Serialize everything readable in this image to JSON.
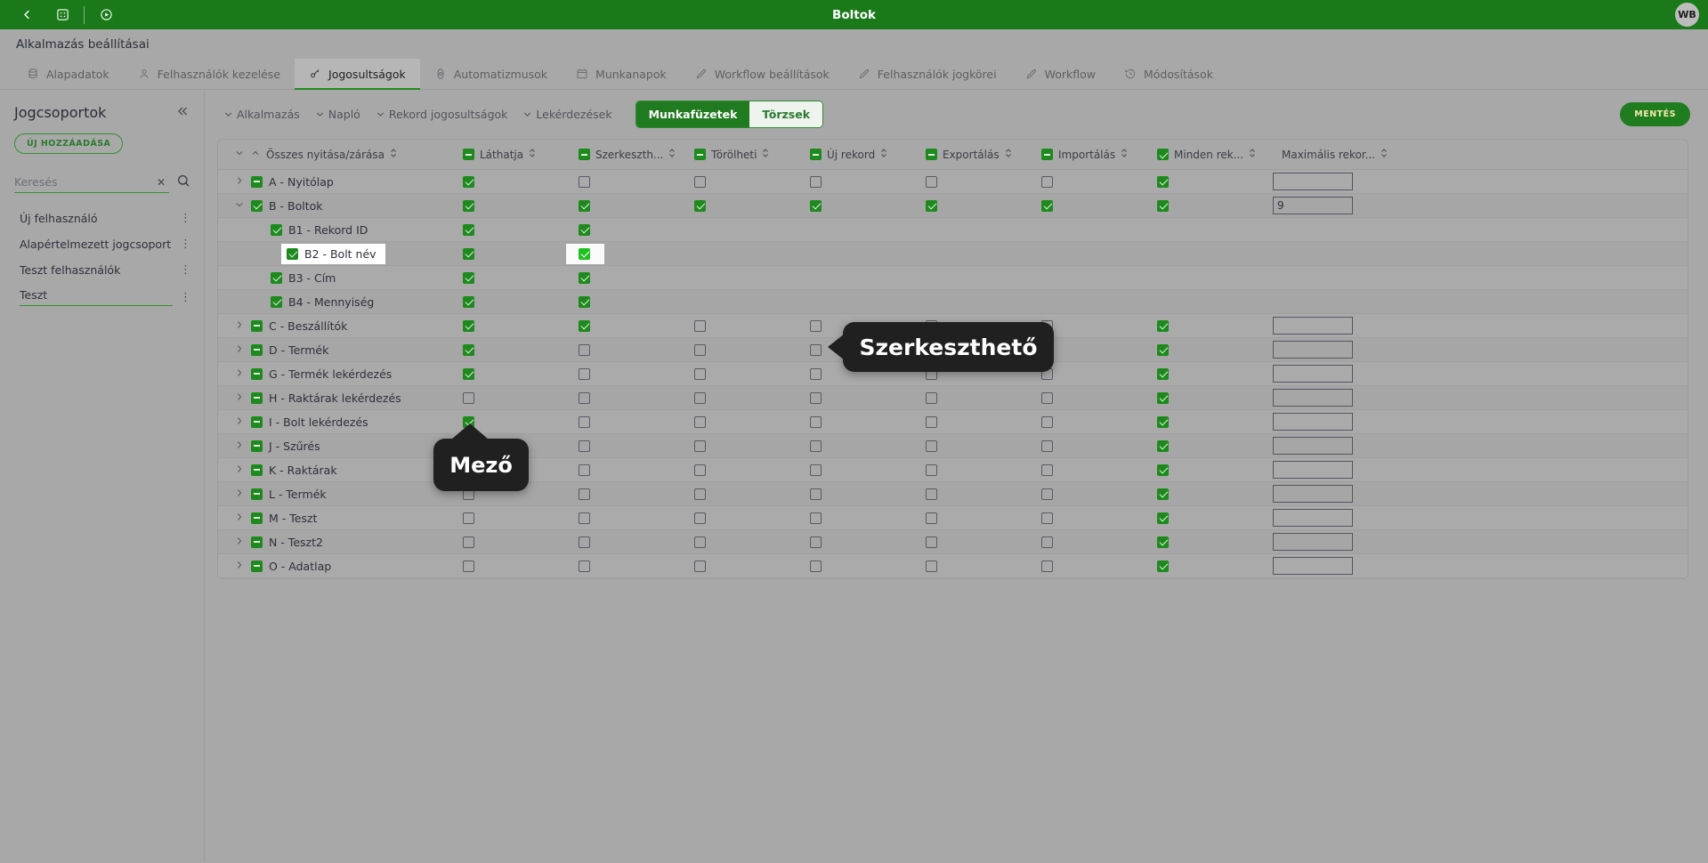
{
  "topbar": {
    "title": "Boltok",
    "back_icon": "chevron-left-icon",
    "apps_icon": "grid-apps-icon",
    "play_icon": "play-circle-icon",
    "avatar_initials": "WB"
  },
  "app_header": {
    "title": "Alkalmazás beállításai"
  },
  "tabs": [
    {
      "label": "Alapadatok",
      "icon": "database-icon",
      "active": false
    },
    {
      "label": "Felhasználók kezelése",
      "icon": "user-icon",
      "active": false
    },
    {
      "label": "Jogosultságok",
      "icon": "key-icon",
      "active": true
    },
    {
      "label": "Automatizmusok",
      "icon": "gear-orbit-icon",
      "active": false
    },
    {
      "label": "Munkanapok",
      "icon": "calendar-icon",
      "active": false
    },
    {
      "label": "Workflow beállítások",
      "icon": "pencil-icon",
      "active": false
    },
    {
      "label": "Felhasználók jogkörei",
      "icon": "pencil-icon",
      "active": false
    },
    {
      "label": "Workflow",
      "icon": "pencil-icon",
      "active": false
    },
    {
      "label": "Módosítások",
      "icon": "history-icon",
      "active": false
    }
  ],
  "sidebar": {
    "title": "Jogcsoportok",
    "collapse_icon": "double-chevron-left-icon",
    "add_button": "ÚJ HOZZÁADÁSA",
    "search": {
      "value": "",
      "placeholder": "Keresés",
      "clear_icon": "close-icon",
      "search_icon": "search-icon"
    },
    "items": [
      {
        "label": "Új felhasználó",
        "menu_icon": "kebab-menu-icon"
      },
      {
        "label": "Alapértelmezett jogcsoport",
        "menu_icon": "kebab-menu-icon"
      },
      {
        "label": "Teszt felhasználók",
        "menu_icon": "kebab-menu-icon"
      }
    ],
    "edit_item": {
      "value": "Teszt",
      "menu_icon": "kebab-menu-icon"
    }
  },
  "filterbar": {
    "chips": [
      {
        "label": "Alkalmazás",
        "icon": "chevron-down-icon"
      },
      {
        "label": "Napló",
        "icon": "chevron-down-icon"
      },
      {
        "label": "Rekord jogosultságok",
        "icon": "chevron-down-icon"
      },
      {
        "label": "Lekérdezések",
        "icon": "chevron-down-icon"
      }
    ],
    "segment": [
      {
        "label": "Munkafüzetek",
        "selected": true
      },
      {
        "label": "Törzsek",
        "selected": false
      }
    ],
    "save_label": "MENTÉS",
    "accent_green": "#1f7d1f"
  },
  "table": {
    "columns": [
      {
        "label": "Összes nyitása/zárása",
        "header_state": null,
        "sort_icon": "sort-icon"
      },
      {
        "label": "Láthatja",
        "header_state": "mixed",
        "sort_icon": "sort-icon"
      },
      {
        "label": "Szerkeszth...",
        "header_state": "mixed",
        "sort_icon": "sort-icon"
      },
      {
        "label": "Törölheti",
        "header_state": "mixed",
        "sort_icon": "sort-icon"
      },
      {
        "label": "Új rekord",
        "header_state": "mixed",
        "sort_icon": "sort-icon"
      },
      {
        "label": "Exportálás",
        "header_state": "mixed",
        "sort_icon": "sort-icon"
      },
      {
        "label": "Importálás",
        "header_state": "mixed",
        "sort_icon": "sort-icon"
      },
      {
        "label": "Minden rek...",
        "header_state": "on",
        "sort_icon": "sort-icon"
      },
      {
        "label": "Maximális rekor...",
        "header_state": null,
        "sort_icon": "sort-icon"
      }
    ],
    "rows": [
      {
        "name": "A - Nyitólap",
        "expander": "collapsed",
        "node": "mixed",
        "indent": 0,
        "highlight": false,
        "states": [
          "on",
          "off",
          "off",
          "off",
          "off",
          "off",
          "on"
        ],
        "max": "",
        "has_max": true
      },
      {
        "name": "B - Boltok",
        "expander": "expanded",
        "node": "on",
        "indent": 0,
        "highlight": false,
        "states": [
          "on",
          "on",
          "on",
          "on",
          "on",
          "on",
          "on"
        ],
        "max": "9",
        "has_max": true
      },
      {
        "name": "B1 - Rekord ID",
        "expander": "none",
        "node": "on",
        "indent": 1,
        "highlight": false,
        "states": [
          "on",
          "on",
          null,
          null,
          null,
          null,
          null
        ],
        "max": "",
        "has_max": false
      },
      {
        "name": "B2 - Bolt név",
        "expander": "none",
        "node": "on",
        "indent": 1,
        "highlight": true,
        "states": [
          "on",
          "on",
          null,
          null,
          null,
          null,
          null
        ],
        "max": "",
        "has_max": false,
        "cb_highlight": 1
      },
      {
        "name": "B3 - Cím",
        "expander": "none",
        "node": "on",
        "indent": 1,
        "highlight": false,
        "states": [
          "on",
          "on",
          null,
          null,
          null,
          null,
          null
        ],
        "max": "",
        "has_max": false
      },
      {
        "name": "B4 - Mennyiség",
        "expander": "none",
        "node": "on",
        "indent": 1,
        "highlight": false,
        "states": [
          "on",
          "on",
          null,
          null,
          null,
          null,
          null
        ],
        "max": "",
        "has_max": false
      },
      {
        "name": "C - Beszállítók",
        "expander": "collapsed",
        "node": "mixed",
        "indent": 0,
        "highlight": false,
        "states": [
          "on",
          "on",
          "off",
          "off",
          "off",
          "off",
          "on"
        ],
        "max": "",
        "has_max": true
      },
      {
        "name": "D - Termék",
        "expander": "collapsed",
        "node": "mixed",
        "indent": 0,
        "highlight": false,
        "states": [
          "on",
          "off",
          "off",
          "off",
          "off",
          "off",
          "on"
        ],
        "max": "",
        "has_max": true
      },
      {
        "name": "G - Termék lekérdezés",
        "expander": "collapsed",
        "node": "mixed",
        "indent": 0,
        "highlight": false,
        "states": [
          "on",
          "off",
          "off",
          "off",
          "off",
          "off",
          "on"
        ],
        "max": "",
        "has_max": true
      },
      {
        "name": "H - Raktárak lekérdezés",
        "expander": "collapsed",
        "node": "mixed",
        "indent": 0,
        "highlight": false,
        "states": [
          "off",
          "off",
          "off",
          "off",
          "off",
          "off",
          "on"
        ],
        "max": "",
        "has_max": true
      },
      {
        "name": "I - Bolt lekérdezés",
        "expander": "collapsed",
        "node": "mixed",
        "indent": 0,
        "highlight": false,
        "states": [
          "on",
          "off",
          "off",
          "off",
          "off",
          "off",
          "on"
        ],
        "max": "",
        "has_max": true
      },
      {
        "name": "J - Szűrés",
        "expander": "collapsed",
        "node": "mixed",
        "indent": 0,
        "highlight": false,
        "states": [
          "off",
          "off",
          "off",
          "off",
          "off",
          "off",
          "on"
        ],
        "max": "",
        "has_max": true
      },
      {
        "name": "K - Raktárak",
        "expander": "collapsed",
        "node": "mixed",
        "indent": 0,
        "highlight": false,
        "states": [
          "off",
          "off",
          "off",
          "off",
          "off",
          "off",
          "on"
        ],
        "max": "",
        "has_max": true
      },
      {
        "name": "L - Termék",
        "expander": "collapsed",
        "node": "mixed",
        "indent": 0,
        "highlight": false,
        "states": [
          "off",
          "off",
          "off",
          "off",
          "off",
          "off",
          "on"
        ],
        "max": "",
        "has_max": true
      },
      {
        "name": "M - Teszt",
        "expander": "collapsed",
        "node": "mixed",
        "indent": 0,
        "highlight": false,
        "states": [
          "off",
          "off",
          "off",
          "off",
          "off",
          "off",
          "on"
        ],
        "max": "",
        "has_max": true
      },
      {
        "name": "N - Teszt2",
        "expander": "collapsed",
        "node": "mixed",
        "indent": 0,
        "highlight": false,
        "states": [
          "off",
          "off",
          "off",
          "off",
          "off",
          "off",
          "on"
        ],
        "max": "",
        "has_max": true
      },
      {
        "name": "O - Adatlap",
        "expander": "collapsed",
        "node": "mixed",
        "indent": 0,
        "highlight": false,
        "states": [
          "off",
          "off",
          "off",
          "off",
          "off",
          "off",
          "on"
        ],
        "max": "",
        "has_max": true
      }
    ]
  },
  "tooltips": [
    {
      "id": "mezo",
      "text": "Mező"
    },
    {
      "id": "szerk",
      "text": "Szerkeszthető"
    }
  ]
}
